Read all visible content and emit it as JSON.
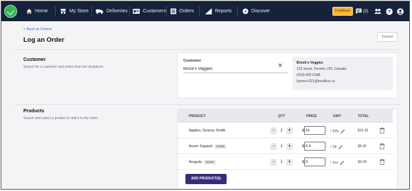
{
  "nav": {
    "items": [
      {
        "label": "Home",
        "icon": "home-icon"
      },
      {
        "label": "My Store",
        "icon": "store-icon"
      },
      {
        "label": "Deliveries",
        "icon": "truck-icon"
      },
      {
        "label": "Customers",
        "icon": "customers-icon"
      },
      {
        "label": "Orders",
        "icon": "orders-icon"
      },
      {
        "label": "Reports",
        "icon": "chart-icon"
      },
      {
        "label": "Discover",
        "icon": "compass-icon"
      }
    ],
    "feedback_label": "Feedback",
    "messages_count": "(0)"
  },
  "header": {
    "back_link": "< Back to Orders",
    "title": "Log an Order",
    "cancel_label": "Cancel"
  },
  "customer_section": {
    "title": "Customer",
    "description": "Search for a customer and select from the dropdown.",
    "field_label": "Customer",
    "field_value": "Brock's Veggies",
    "info": {
      "name": "Brock's Veggies",
      "address": "123 street, Toronto, ON, Canada",
      "phone": "(416) 402-0188",
      "email": "lyonev+321@localline.ca"
    }
  },
  "products_section": {
    "title": "Products",
    "description": "Search and select a product to add it to the order.",
    "columns": {
      "product": "PRODUCT",
      "qty": "QTY",
      "price": "PRICE",
      "unit": "UNIT",
      "total": "TOTAL"
    },
    "rows": [
      {
        "name": "Apples, Granny Smith",
        "tag": "",
        "qty": "1",
        "price": "15",
        "unit": "/ 10lb",
        "total": "$15.00"
      },
      {
        "name": "Acorn Squash",
        "tag": "TAXED",
        "qty": "1",
        "price": "6.9",
        "unit": "/ 1lb",
        "total": "$6.90"
      },
      {
        "name": "Arugula",
        "tag": "TAXED",
        "qty": "1",
        "price": "0",
        "unit": "/ 1ea",
        "total": "$0.00"
      }
    ],
    "add_button": "ADD PRODUCT(S)"
  },
  "colors": {
    "nav_bg": "#16213a",
    "accent": "#3b2a7a",
    "brand_green": "#33b35a",
    "feedback": "#f6b73c"
  }
}
